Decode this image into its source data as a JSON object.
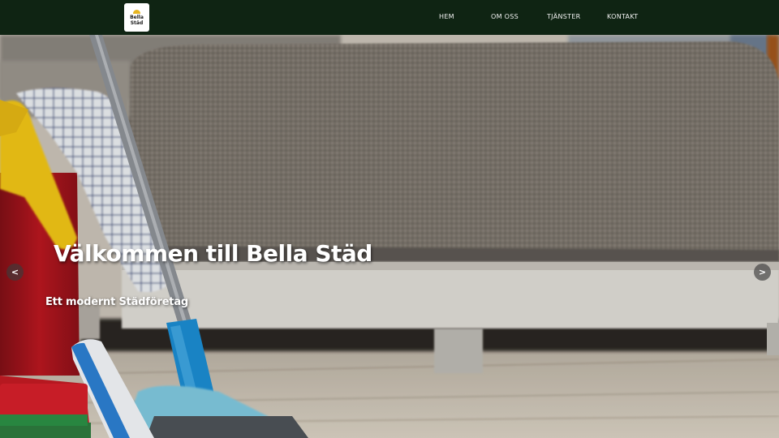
{
  "brand": {
    "logo_line1": "Bella",
    "logo_line2": "Städ"
  },
  "nav": {
    "items": [
      {
        "label": "HEM"
      },
      {
        "label": "OM OSS"
      },
      {
        "label": "TJÄNSTER"
      },
      {
        "label": "KONTAKT"
      }
    ]
  },
  "hero": {
    "title": "Välkommen till Bella Städ",
    "subtitle": "Ett modernt Städföretag",
    "prev_label": "<",
    "next_label": ">"
  },
  "colors": {
    "navbar": "#0f2413",
    "nav_text": "#f2f2f2",
    "hero_text": "#ffffff",
    "logo_accent": "#e6b521"
  },
  "icons": {
    "prev": "chevron-left-icon",
    "next": "chevron-right-icon"
  }
}
